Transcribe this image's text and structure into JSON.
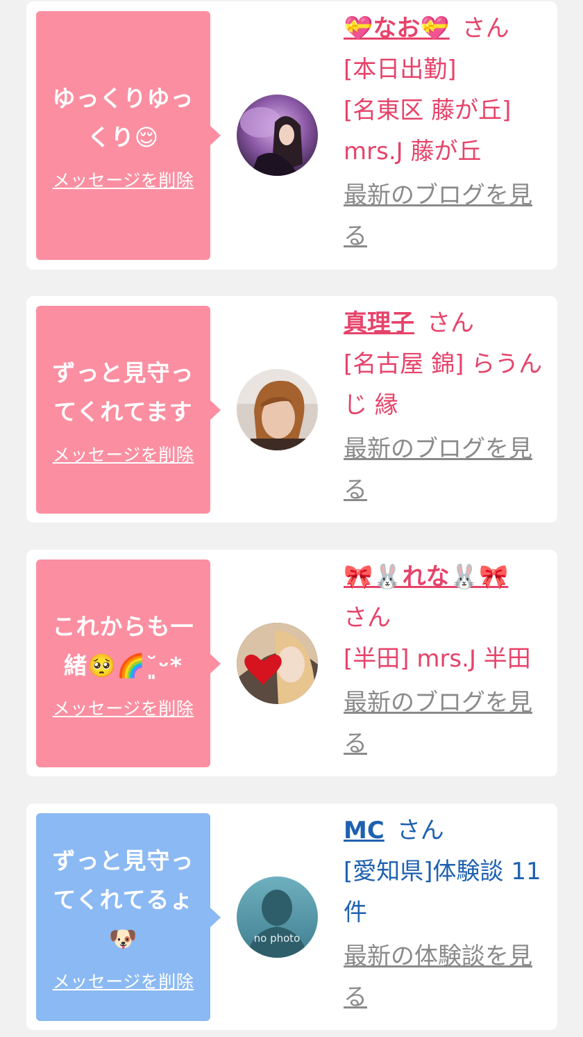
{
  "colors": {
    "pink_bubble": "#fb8fa1",
    "blue_bubble": "#8bb9f3",
    "pink_text": "#e6436a",
    "blue_text": "#1f61b0",
    "link_gray": "#8a8a8a"
  },
  "messages": [
    {
      "message": "ゆっくりゆっくり😌",
      "delete_label": "メッセージを削除",
      "name": "💝なお💝",
      "honorific": "さん",
      "status": "[本日出勤]",
      "shop": "[名東区 藤が丘] mrs.J 藤が丘",
      "link": "最新のブログを見る",
      "avatar_icon": "profile-photo"
    },
    {
      "message": "ずっと見守ってくれてます",
      "delete_label": "メッセージを削除",
      "name": "真理子",
      "honorific": "さん",
      "shop": "[名古屋 錦] らうんじ 縁",
      "link": "最新のブログを見る",
      "avatar_icon": "profile-photo"
    },
    {
      "message": "これからも一緒🥺🌈˘͈ᵕ*",
      "delete_label": "メッセージを削除",
      "name": "🎀🐰れな🐰🎀",
      "honorific": "さん",
      "shop": "[半田] mrs.J 半田",
      "link": "最新のブログを見る",
      "avatar_icon": "profile-photo"
    },
    {
      "message": "ずっと見守ってくれてるょ🐶",
      "delete_label": "メッセージを削除",
      "name": "MC",
      "honorific": "さん",
      "shop": "[愛知県]体験談 11件",
      "link": "最新の体験談を見る",
      "avatar_text": "no photo",
      "avatar_icon": "no-photo-silhouette"
    }
  ]
}
